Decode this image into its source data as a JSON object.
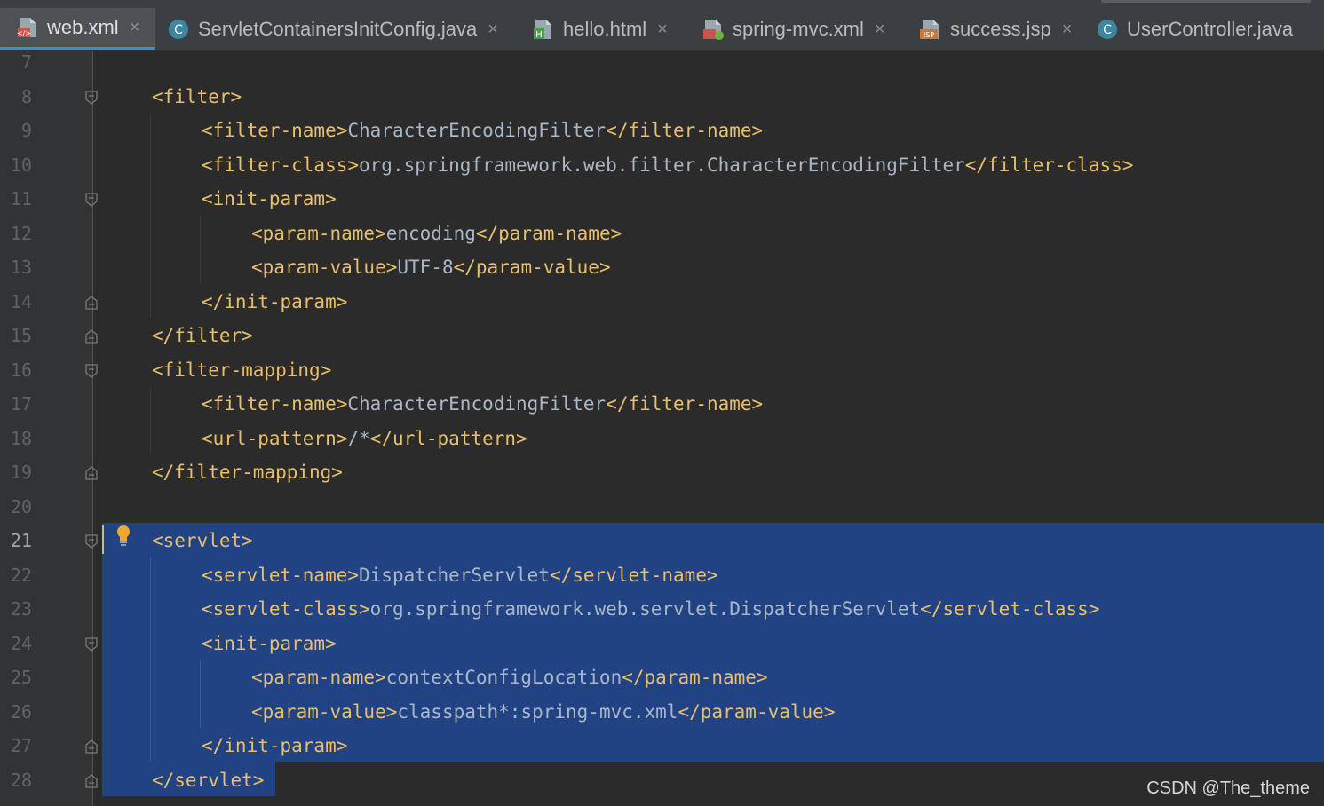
{
  "tabs": [
    {
      "label": "web.xml",
      "icon": "xml-file-icon",
      "active": true
    },
    {
      "label": "ServletContainersInitConfig.java",
      "icon": "java-class-icon",
      "active": false
    },
    {
      "label": "hello.html",
      "icon": "html-file-icon",
      "active": false
    },
    {
      "label": "spring-mvc.xml",
      "icon": "spring-xml-file-icon",
      "active": false
    },
    {
      "label": "success.jsp",
      "icon": "jsp-file-icon",
      "active": false
    },
    {
      "label": "UserController.java",
      "icon": "java-class-icon",
      "active": false
    }
  ],
  "close_symbol": "×",
  "editor": {
    "current_line": 21,
    "lines": [
      {
        "n": "7",
        "t": ""
      },
      {
        "n": "8",
        "t": "<filter>"
      },
      {
        "n": "9",
        "t": "<filter-name>",
        "v": "CharacterEncodingFilter",
        "c": "</filter-name>"
      },
      {
        "n": "10",
        "t": "<filter-class>",
        "v": "org.springframework.web.filter.CharacterEncodingFilter",
        "c": "</filter-class>"
      },
      {
        "n": "11",
        "t": "<init-param>"
      },
      {
        "n": "12",
        "t": "<param-name>",
        "v": "encoding",
        "c": "</param-name>"
      },
      {
        "n": "13",
        "t": "<param-value>",
        "v": "UTF-8",
        "c": "</param-value>"
      },
      {
        "n": "14",
        "t": "</init-param>"
      },
      {
        "n": "15",
        "t": "</filter>"
      },
      {
        "n": "16",
        "t": "<filter-mapping>"
      },
      {
        "n": "17",
        "t": "<filter-name>",
        "v": "CharacterEncodingFilter",
        "c": "</filter-name>"
      },
      {
        "n": "18",
        "t": "<url-pattern>",
        "v": "/*",
        "c": "</url-pattern>"
      },
      {
        "n": "19",
        "t": "</filter-mapping>"
      },
      {
        "n": "20",
        "t": ""
      },
      {
        "n": "21",
        "t": "<servlet>"
      },
      {
        "n": "22",
        "t": "<servlet-name>",
        "v": "DispatcherServlet",
        "c": "</servlet-name>"
      },
      {
        "n": "23",
        "t": "<servlet-class>",
        "v": "org.springframework.web.servlet.DispatcherServlet",
        "c": "</servlet-class>"
      },
      {
        "n": "24",
        "t": "<init-param>"
      },
      {
        "n": "25",
        "t": "<param-name>",
        "v": "contextConfigLocation",
        "c": "</param-name>"
      },
      {
        "n": "26",
        "t": "<param-value>",
        "v": "classpath*:spring-mvc.xml",
        "c": "</param-value>"
      },
      {
        "n": "27",
        "t": "</init-param>"
      },
      {
        "n": "28",
        "t": "</servlet>"
      }
    ]
  },
  "watermark": "CSDN @The_theme",
  "colors": {
    "tag": "#e8bf6a",
    "text": "#a9b7c6",
    "selection": "#214283",
    "background": "#2b2b2b",
    "tab_underline": "#4a88c7"
  }
}
